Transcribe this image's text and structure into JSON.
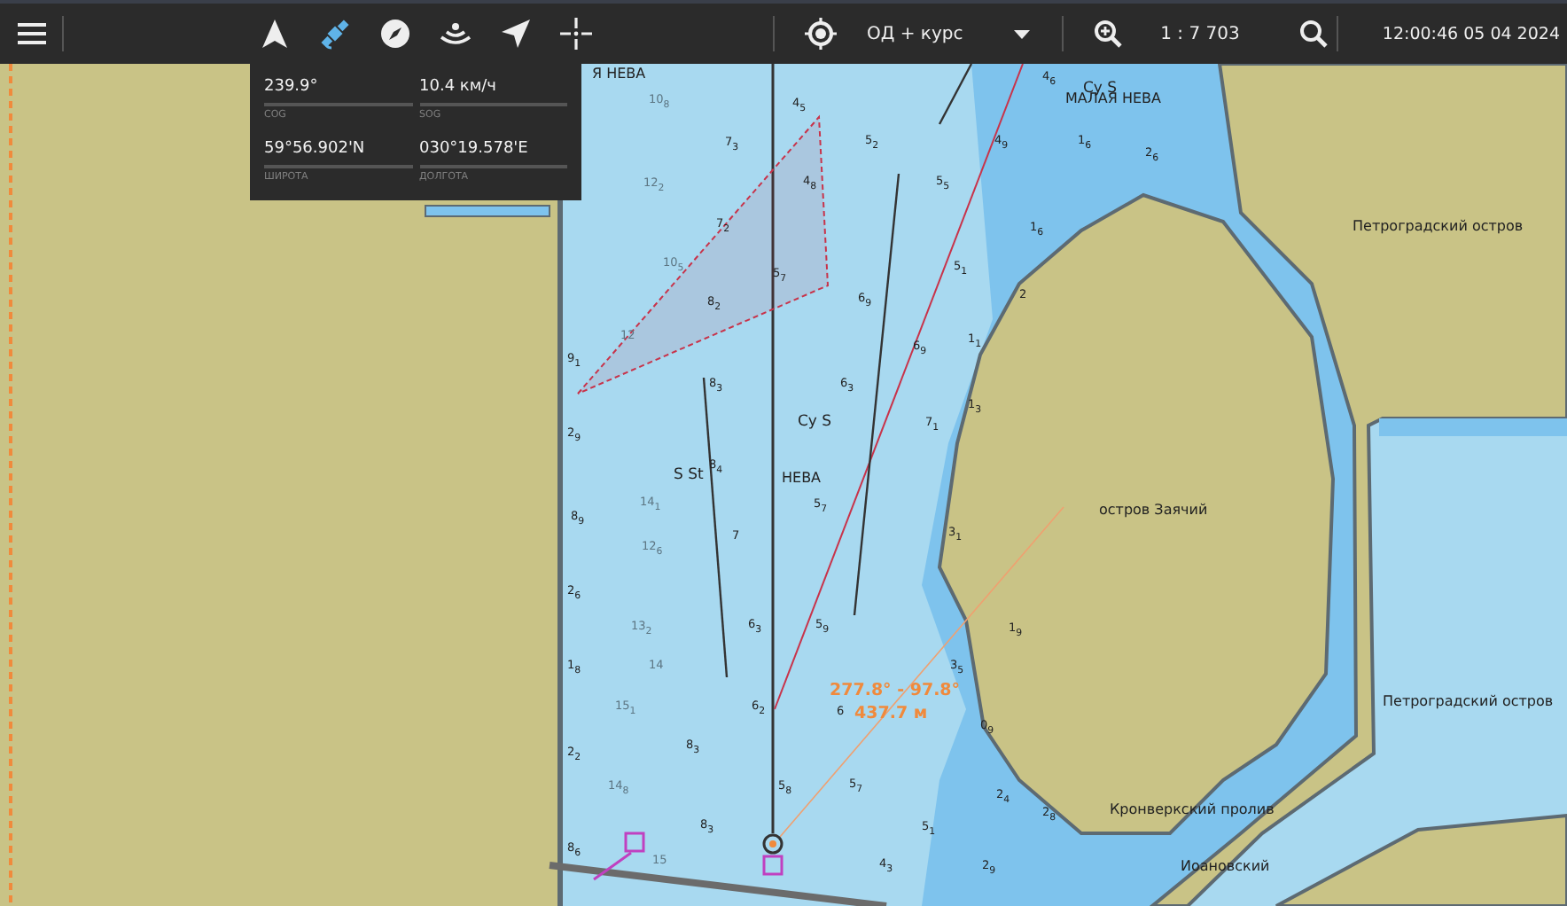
{
  "toolbar": {
    "left_tools": [
      {
        "kind": "north-up",
        "selected": false
      },
      {
        "kind": "satellite",
        "selected": true
      },
      {
        "kind": "compass",
        "selected": false
      },
      {
        "kind": "signal",
        "selected": false
      },
      {
        "kind": "navigate",
        "selected": false
      },
      {
        "kind": "crosshair",
        "selected": false
      }
    ],
    "mode": {
      "value": "ОД + курс"
    },
    "scale": "1 : 7 703",
    "datetime": "12:00:46 05 04 2024"
  },
  "info_panel": {
    "fields": [
      {
        "value": "239.9°",
        "label": "COG"
      },
      {
        "value": "10.4 км/ч",
        "label": "SOG"
      },
      {
        "value": "59°56.902'N",
        "label": "ШИРОТА"
      },
      {
        "value": "030°19.578'E",
        "label": "ДОЛГОТА"
      }
    ]
  },
  "map": {
    "labels": [
      {
        "kind": "water",
        "text": "Я НЕВА"
      },
      {
        "kind": "water",
        "text": "МАЛАЯ НЕВА"
      },
      {
        "kind": "feature",
        "text": "Cy S"
      },
      {
        "kind": "place",
        "text": "Петроградский остров"
      },
      {
        "kind": "feature",
        "text": "Cy S"
      },
      {
        "kind": "feature",
        "text": "S St"
      },
      {
        "kind": "water",
        "text": "НЕВА"
      },
      {
        "kind": "place",
        "text": "остров Заячий"
      },
      {
        "kind": "place",
        "text": "Петроградский остров"
      },
      {
        "kind": "measure",
        "text": "277.8° - 97.8°"
      },
      {
        "kind": "measure",
        "text": "437.7 м"
      },
      {
        "kind": "place",
        "text": "Кронверкский пролив"
      },
      {
        "kind": "place",
        "text": "Иоановский"
      }
    ],
    "soundings": [
      {
        "kind": "deep",
        "text": "4$_{5}$"
      },
      {
        "kind": "deep",
        "text": "7$_{3}$"
      },
      {
        "kind": "deep",
        "text": "5$_{2}$"
      },
      {
        "kind": "deep",
        "text": "4$_{9}$"
      },
      {
        "kind": "deep",
        "text": "4$_{6}$"
      },
      {
        "kind": "deep",
        "text": "4$_{8}$"
      },
      {
        "kind": "deep",
        "text": "7$_{2}$"
      },
      {
        "kind": "deep",
        "text": "5$_{5}$"
      },
      {
        "kind": "deep",
        "text": "1$_{6}$"
      },
      {
        "kind": "deep",
        "text": "5$_{7}$"
      },
      {
        "kind": "deep",
        "text": "8$_{2}$"
      },
      {
        "kind": "deep",
        "text": "6$_{9}$"
      },
      {
        "kind": "deep",
        "text": "5$_{1}$"
      },
      {
        "kind": "deep",
        "text": "2"
      },
      {
        "kind": "deep",
        "text": "9$_{1}$"
      },
      {
        "kind": "deep",
        "text": "6$_{9}$"
      },
      {
        "kind": "deep",
        "text": "1$_{1}$"
      },
      {
        "kind": "deep",
        "text": "8$_{3}$"
      },
      {
        "kind": "deep",
        "text": "6$_{3}$"
      },
      {
        "kind": "deep",
        "text": "7$_{1}$"
      },
      {
        "kind": "deep",
        "text": "1$_{3}$"
      },
      {
        "kind": "deep",
        "text": "2$_{9}$"
      },
      {
        "kind": "deep",
        "text": "8$_{4}$"
      },
      {
        "kind": "deep",
        "text": "5$_{7}$"
      },
      {
        "kind": "deep",
        "text": "8$_{9}$"
      },
      {
        "kind": "deep",
        "text": "7"
      },
      {
        "kind": "deep",
        "text": "3$_{1}$"
      },
      {
        "kind": "deep",
        "text": "2$_{6}$"
      },
      {
        "kind": "deep",
        "text": "6$_{3}$"
      },
      {
        "kind": "deep",
        "text": "5$_{9}$"
      },
      {
        "kind": "deep",
        "text": "1$_{9}$"
      },
      {
        "kind": "deep",
        "text": "1$_{8}$"
      },
      {
        "kind": "deep",
        "text": "3$_{5}$"
      },
      {
        "kind": "deep",
        "text": "6$_{2}$"
      },
      {
        "kind": "deep",
        "text": "6"
      },
      {
        "kind": "deep",
        "text": "0$_{9}$"
      },
      {
        "kind": "deep",
        "text": "2$_{2}$"
      },
      {
        "kind": "deep",
        "text": "8$_{3}$"
      },
      {
        "kind": "deep",
        "text": "5$_{8}$"
      },
      {
        "kind": "deep",
        "text": "5$_{7}$"
      },
      {
        "kind": "deep",
        "text": "2$_{4}$"
      },
      {
        "kind": "deep",
        "text": "2$_{8}$"
      },
      {
        "kind": "deep",
        "text": "8$_{6}$"
      },
      {
        "kind": "deep",
        "text": "8$_{3}$"
      },
      {
        "kind": "deep",
        "text": "5$_{1}$"
      },
      {
        "kind": "deep",
        "text": "4$_{3}$"
      },
      {
        "kind": "deep",
        "text": "2$_{9}$"
      },
      {
        "kind": "deep",
        "text": "1$_{6}$"
      },
      {
        "kind": "deep",
        "text": "2$_{6}$"
      },
      {
        "kind": "faint",
        "text": "10$_{8}$"
      },
      {
        "kind": "faint",
        "text": "12$_{2}$"
      },
      {
        "kind": "faint",
        "text": "10$_{5}$"
      },
      {
        "kind": "faint",
        "text": "12"
      },
      {
        "kind": "faint",
        "text": "14$_{1}$"
      },
      {
        "kind": "faint",
        "text": "12$_{6}$"
      },
      {
        "kind": "faint",
        "text": "13$_{2}$"
      },
      {
        "kind": "faint",
        "text": "14"
      },
      {
        "kind": "faint",
        "text": "15$_{1}$"
      },
      {
        "kind": "faint",
        "text": "14$_{8}$"
      },
      {
        "kind": "faint",
        "text": "15"
      }
    ]
  }
}
